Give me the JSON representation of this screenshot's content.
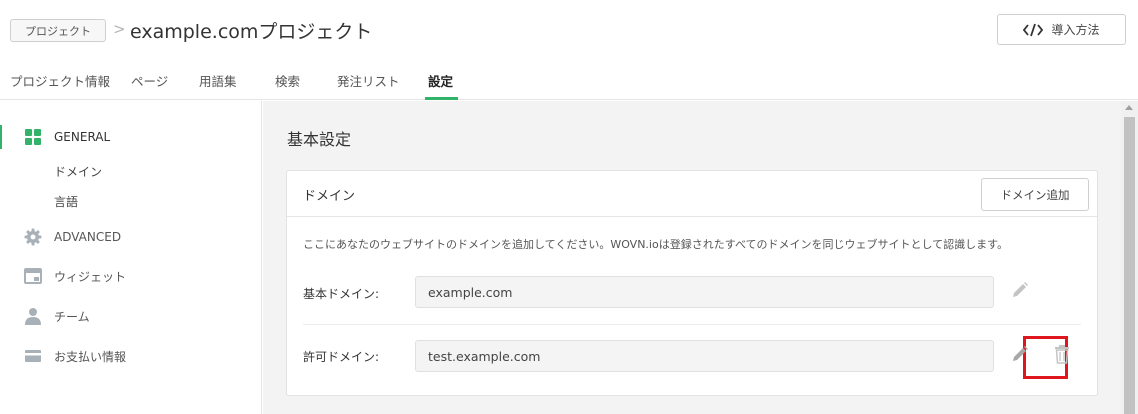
{
  "header": {
    "breadcrumb_label": "プロジェクト",
    "breadcrumb_separator": ">",
    "title": "example.comプロジェクト",
    "install_button_label": "導入方法",
    "install_icon": "code-icon"
  },
  "tabs": [
    {
      "label": "プロジェクト情報",
      "active": false
    },
    {
      "label": "ページ",
      "active": false
    },
    {
      "label": "用語集",
      "active": false
    },
    {
      "label": "検索",
      "active": false
    },
    {
      "label": "発注リスト",
      "active": false
    },
    {
      "label": "設定",
      "active": true
    }
  ],
  "sidebar": {
    "items": [
      {
        "label": "GENERAL",
        "icon": "grid-icon",
        "active": true
      },
      {
        "label": "ADVANCED",
        "icon": "gear-icon",
        "active": false
      },
      {
        "label": "ウィジェット",
        "icon": "widget-icon",
        "active": false
      },
      {
        "label": "チーム",
        "icon": "person-icon",
        "active": false
      },
      {
        "label": "お支払い情報",
        "icon": "card-icon",
        "active": false
      }
    ],
    "general_subitems": [
      "ドメイン",
      "言語"
    ]
  },
  "main": {
    "section_title": "基本設定",
    "domain_card": {
      "title": "ドメイン",
      "add_button_label": "ドメイン追加",
      "description": "ここにあなたのウェブサイトのドメインを追加してください。WOVN.ioは登録されたすべてのドメインを同じウェブサイトとして認識します。",
      "rows": [
        {
          "label": "基本ドメイン:",
          "value": "example.com",
          "actions": [
            "pencil-icon"
          ]
        },
        {
          "label": "許可ドメイン:",
          "value": "test.example.com",
          "actions": [
            "pencil-icon",
            "trash-icon"
          ]
        }
      ]
    }
  },
  "colors": {
    "accent_green": "#33b369",
    "highlight_red": "#e0161e",
    "main_background": "#f3f3f3"
  }
}
